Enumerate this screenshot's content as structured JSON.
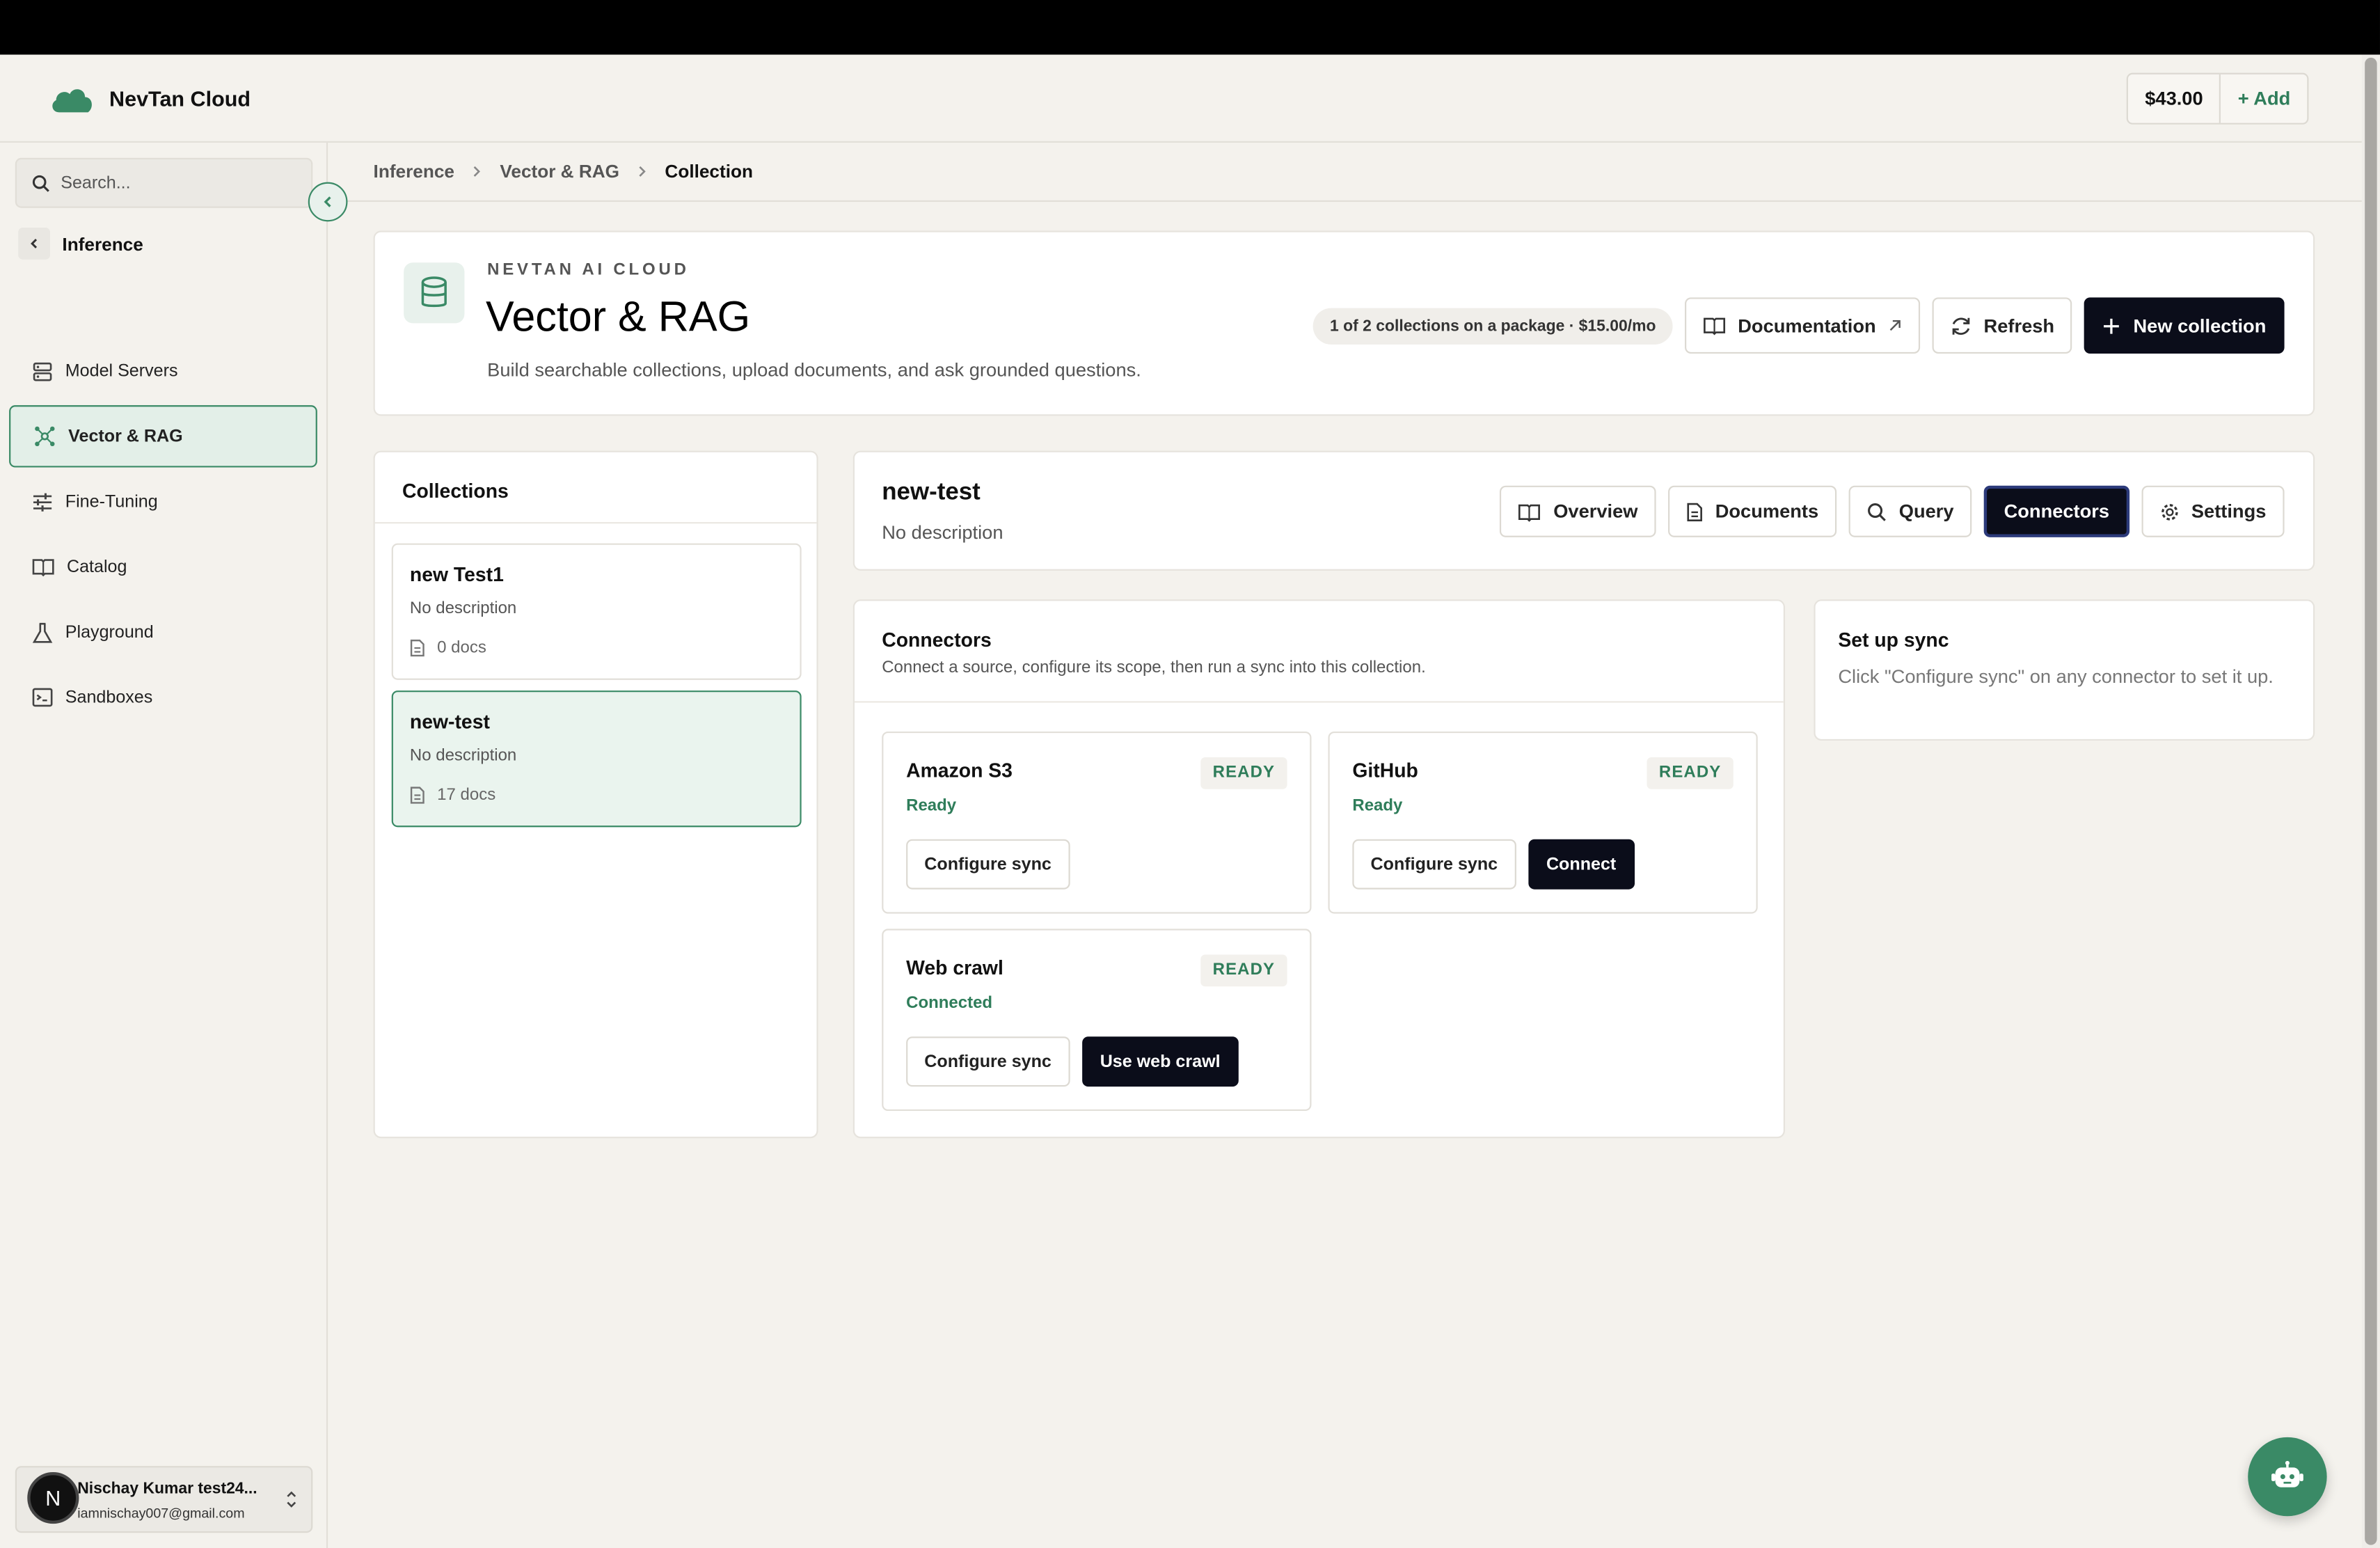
{
  "app": {
    "name": "NevTan Cloud"
  },
  "balance": {
    "amount": "$43.00",
    "add_label": "+ Add"
  },
  "sidebar": {
    "search_placeholder": "Search...",
    "back_label": "Inference",
    "items": [
      {
        "label": "Model Servers",
        "icon": "server-icon"
      },
      {
        "label": "Vector & RAG",
        "icon": "network-icon",
        "active": true
      },
      {
        "label": "Fine-Tuning",
        "icon": "sliders-icon"
      },
      {
        "label": "Catalog",
        "icon": "book-icon"
      },
      {
        "label": "Playground",
        "icon": "flask-icon"
      },
      {
        "label": "Sandboxes",
        "icon": "terminal-icon"
      }
    ],
    "user": {
      "initial": "N",
      "name": "Nischay Kumar test24...",
      "email": "iamnischay007@gmail.com"
    }
  },
  "breadcrumb": [
    "Inference",
    "Vector & RAG",
    "Collection"
  ],
  "hero": {
    "eyebrow": "NEVTAN AI CLOUD",
    "title": "Vector & RAG",
    "subtitle": "Build searchable collections, upload documents, and ask grounded questions.",
    "pill": "1 of 2 collections on a package · $15.00/mo",
    "documentation_label": "Documentation",
    "refresh_label": "Refresh",
    "new_collection_label": "New collection"
  },
  "collections": {
    "title": "Collections",
    "items": [
      {
        "name": "new Test1",
        "description": "No description",
        "docs": "0 docs"
      },
      {
        "name": "new-test",
        "description": "No description",
        "docs": "17 docs",
        "selected": true
      }
    ]
  },
  "detail": {
    "title": "new-test",
    "description": "No description",
    "tabs": [
      {
        "label": "Overview",
        "icon": "book-icon"
      },
      {
        "label": "Documents",
        "icon": "document-icon"
      },
      {
        "label": "Query",
        "icon": "search-icon"
      },
      {
        "label": "Connectors",
        "active": true
      },
      {
        "label": "Settings",
        "icon": "gear-icon"
      }
    ]
  },
  "connectors": {
    "title": "Connectors",
    "subtitle": "Connect a source, configure its scope, then run a sync into this collection.",
    "items": [
      {
        "name": "Amazon S3",
        "badge": "READY",
        "status": "Ready",
        "buttons": [
          "Configure sync"
        ]
      },
      {
        "name": "GitHub",
        "badge": "READY",
        "status": "Ready",
        "buttons": [
          "Configure sync",
          "Connect"
        ]
      },
      {
        "name": "Web crawl",
        "badge": "READY",
        "status": "Connected",
        "buttons": [
          "Configure sync",
          "Use web crawl"
        ]
      }
    ]
  },
  "sync": {
    "title": "Set up sync",
    "text": "Click \"Configure sync\" on any connector to set it up."
  },
  "colors": {
    "accent": "#3a8a66",
    "dark": "#0b0d1a",
    "background": "#f4f2ed"
  }
}
